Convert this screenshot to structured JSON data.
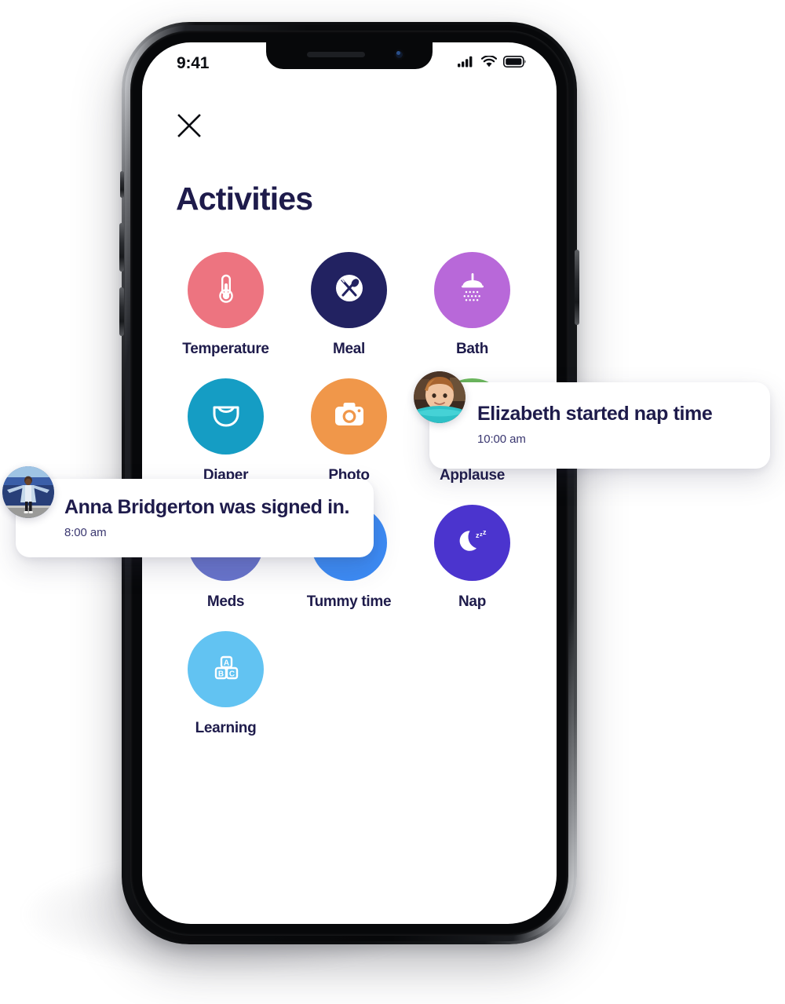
{
  "status_bar": {
    "time": "9:41",
    "signal_icon": "cellular-signal-icon",
    "wifi_icon": "wifi-icon",
    "battery_icon": "battery-full-icon"
  },
  "screen": {
    "close_icon": "close-x-icon",
    "title": "Activities"
  },
  "activities": [
    {
      "label": "Temperature",
      "color": "#ED7480",
      "icon": "thermometer-icon"
    },
    {
      "label": "Meal",
      "color": "#222261",
      "icon": "fork-spoon-icon"
    },
    {
      "label": "Bath",
      "color": "#B868D9",
      "icon": "shower-icon"
    },
    {
      "label": "Diaper",
      "color": "#159DC4",
      "icon": "diaper-icon"
    },
    {
      "label": "Photo",
      "color": "#F0974A",
      "icon": "camera-icon"
    },
    {
      "label": "Applause",
      "color": "#6DBA5E",
      "icon": "clapping-hand-icon"
    },
    {
      "label": "Meds",
      "color": "#6874CC",
      "icon": "first-aid-kit-icon"
    },
    {
      "label": "Tummy time",
      "color": "#3C8BF5",
      "icon": "baby-icon"
    },
    {
      "label": "Nap",
      "color": "#4B34CE",
      "icon": "moon-zzz-icon"
    },
    {
      "label": "Learning",
      "color": "#62C3F2",
      "icon": "abc-blocks-icon"
    }
  ],
  "notifications": [
    {
      "id": "nap",
      "title": "Elizabeth started nap time",
      "time": "10:00 am",
      "avatar": "child-photo-avatar"
    },
    {
      "id": "signin",
      "title": "Anna Bridgerton was signed in.",
      "time": "8:00 am",
      "avatar": "person-photo-avatar"
    }
  ],
  "theme": {
    "text_dark": "#1E1B4B",
    "background": "#FFFFFF"
  }
}
